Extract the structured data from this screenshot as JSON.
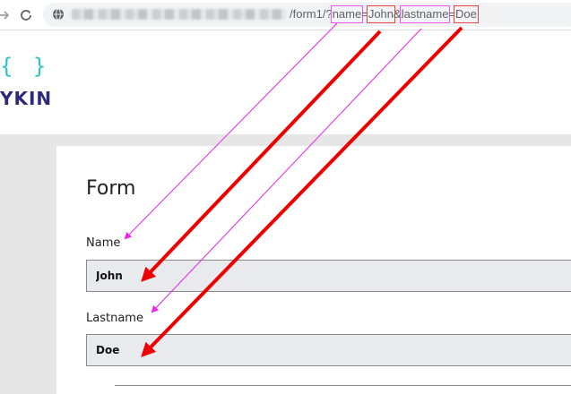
{
  "browser": {
    "url_visible": "/form1/?",
    "url_params": [
      {
        "text": "name",
        "highlight": "pink"
      },
      {
        "text": "=",
        "highlight": "none"
      },
      {
        "text": "John",
        "highlight": "red"
      },
      {
        "text": "&",
        "highlight": "none"
      },
      {
        "text": "lastname",
        "highlight": "pink"
      },
      {
        "text": "=",
        "highlight": "none"
      },
      {
        "text": "Doe",
        "highlight": "red"
      }
    ],
    "icons": [
      "forward-arrow-icon",
      "reload-icon",
      "site-info-icon"
    ]
  },
  "logo": {
    "braces": "{ }",
    "text": "YKIN"
  },
  "form": {
    "title": "Form",
    "fields": [
      {
        "label": "Name",
        "value": "John"
      },
      {
        "label": "Lastname",
        "value": "Doe"
      }
    ]
  },
  "colors": {
    "param_key_highlight": "#ee55ee",
    "param_value_highlight": "#ee4444",
    "arrow_key": "#ee22ee",
    "arrow_value": "#ee0000",
    "logo_brace": "#2ec4c4",
    "logo_text": "#2e2a7a"
  }
}
